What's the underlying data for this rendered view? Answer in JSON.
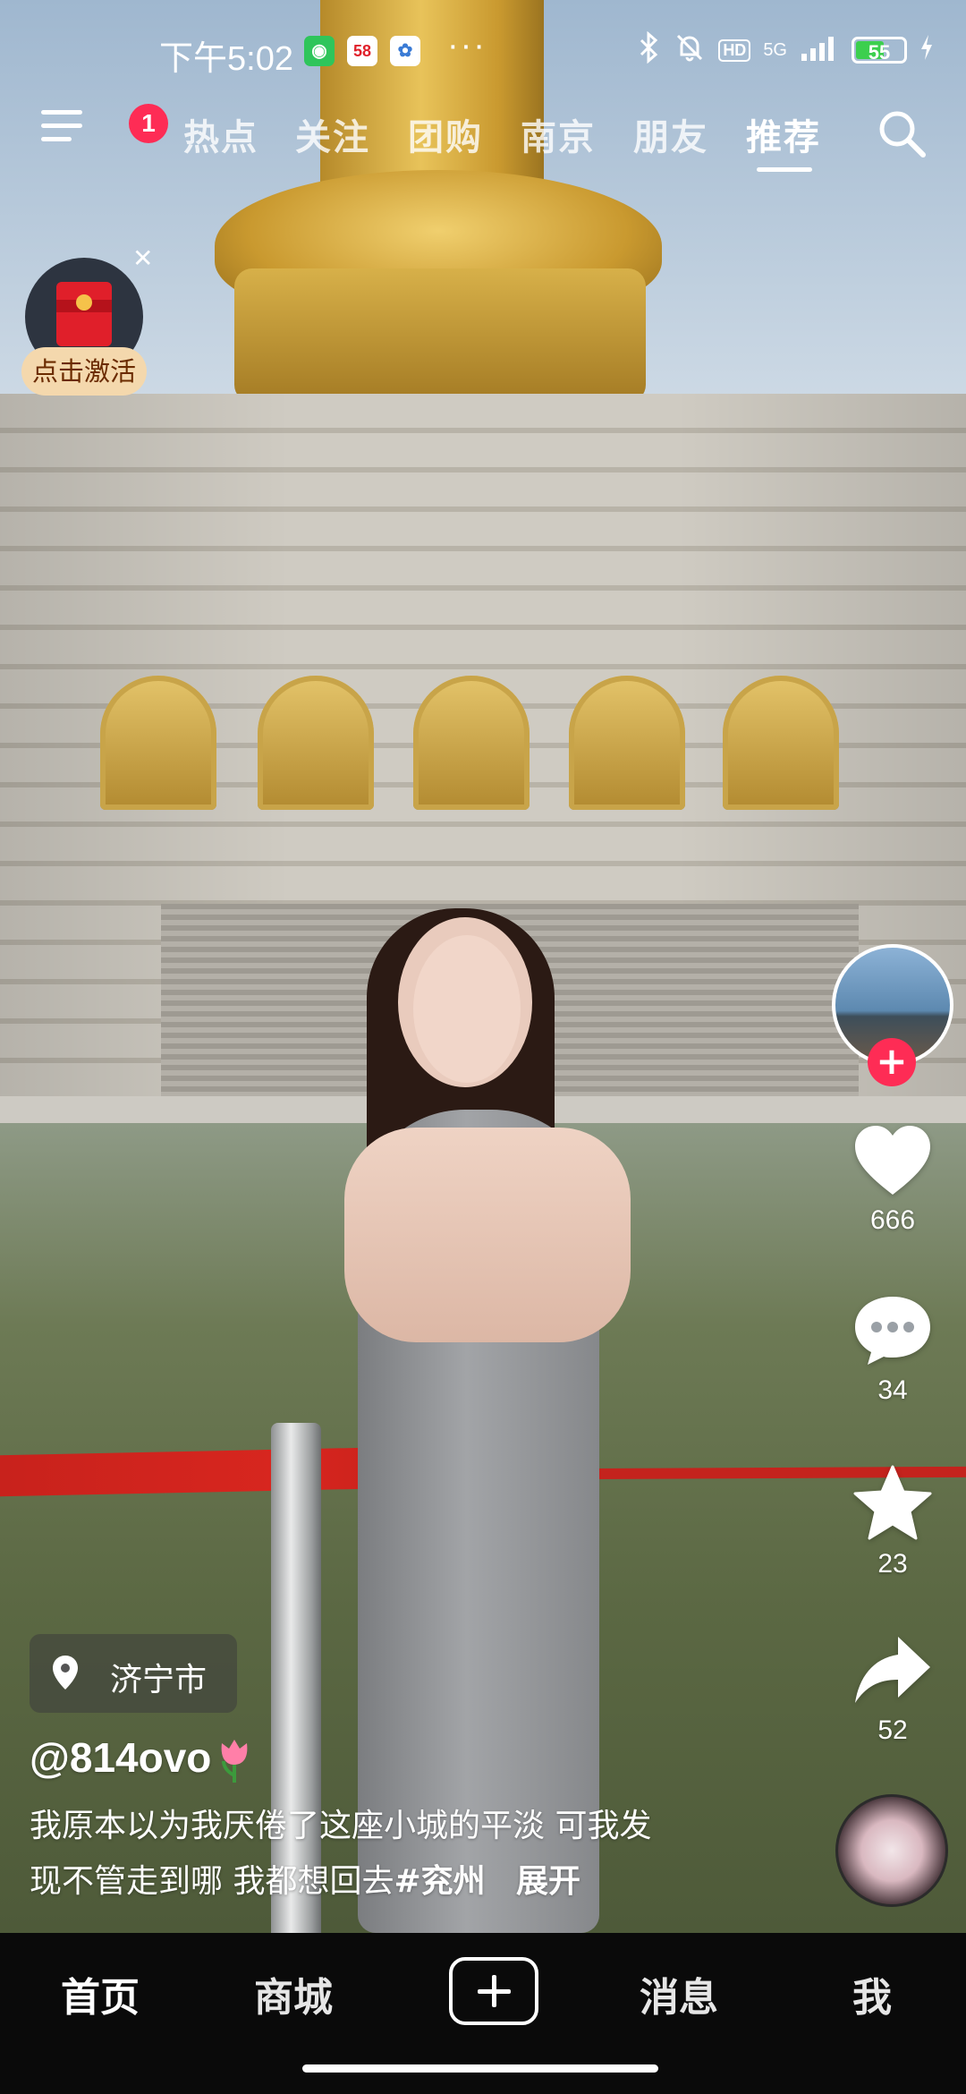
{
  "status_bar": {
    "time": "下午5:02",
    "icons": [
      "wechat-icon",
      "58-app-icon",
      "cloud-app-icon",
      "more-dots",
      "bluetooth-icon",
      "mute-bell-icon",
      "hd-icon",
      "5g-icon",
      "signal-icon",
      "battery-icon",
      "charging-icon"
    ],
    "more": "···",
    "hd": "HD",
    "network": "5G",
    "battery": "55"
  },
  "top_nav": {
    "notification_count": "1",
    "tabs": [
      {
        "label": "热点",
        "active": false
      },
      {
        "label": "关注",
        "active": false
      },
      {
        "label": "团购",
        "active": false
      },
      {
        "label": "南京",
        "active": false
      },
      {
        "label": "朋友",
        "active": false
      },
      {
        "label": "推荐",
        "active": true
      }
    ]
  },
  "promo": {
    "label": "点击激活"
  },
  "actions": {
    "likes": "666",
    "comments": "34",
    "favorites": "23",
    "shares": "52"
  },
  "video": {
    "location": "济宁市",
    "author": "@814ovo",
    "description_line1": "我原本以为我厌倦了这座小城的平淡  可我发",
    "description_line2": "现不管走到哪 我都想回去",
    "hashtag": "#兖州",
    "expand": "展开"
  },
  "bottom_nav": {
    "items": [
      {
        "label": "首页",
        "active": true
      },
      {
        "label": "商城",
        "active": false
      },
      {
        "label": "消息",
        "active": false
      },
      {
        "label": "我",
        "active": false
      }
    ]
  },
  "colors": {
    "accent": "#fe2c55",
    "bottom_bar": "#0a0a0a",
    "promo_bg": "#f4d8ad"
  }
}
